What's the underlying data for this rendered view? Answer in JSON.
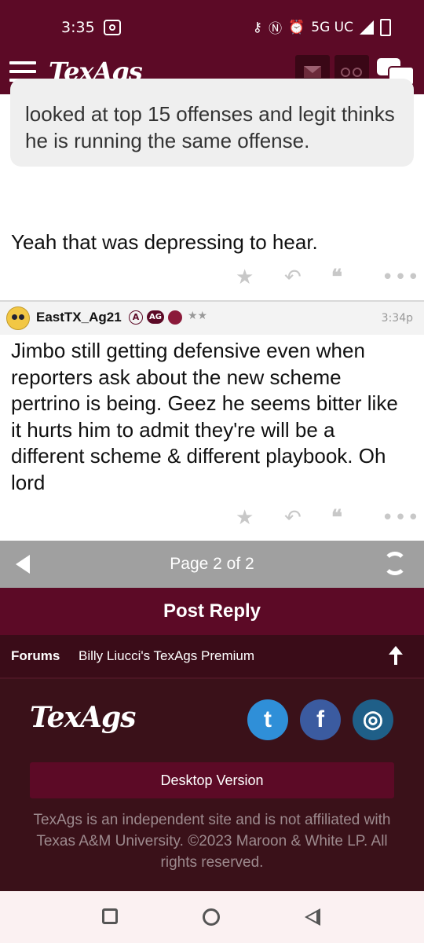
{
  "status_bar": {
    "time": "3:35",
    "network": "5G UC"
  },
  "navbar": {
    "logo": "TexAgs"
  },
  "quoted_post": {
    "text": "looked at top 15 offenses and legit thinks he is running the same offense."
  },
  "post1": {
    "text": "Yeah that was depressing to hear."
  },
  "post2": {
    "username": "EastTX_Ag21",
    "badge_a": "A",
    "badge_ag": "AG",
    "stars": "★★",
    "time": "3:34p",
    "text": "Jimbo still getting defensive even when reporters ask about the new scheme pertrino is being. Geez he seems bitter like it hurts him to admit they're will be a different scheme & different playbook. Oh lord"
  },
  "pager": {
    "label": "Page 2 of 2"
  },
  "post_reply": {
    "label": "Post Reply"
  },
  "breadcrumb": {
    "forums": "Forums",
    "board": "Billy Liucci's TexAgs Premium"
  },
  "footer": {
    "logo": "TexAgs",
    "desktop_button": "Desktop Version",
    "disclaimer": "TexAgs is an independent site and is not affiliated with Texas A&M University. ©2023 Maroon & White LP. All rights reserved."
  },
  "colors": {
    "maroon": "#5c0a26",
    "footer_bg": "#3a1119",
    "pager_bg": "#a0a0a0"
  }
}
